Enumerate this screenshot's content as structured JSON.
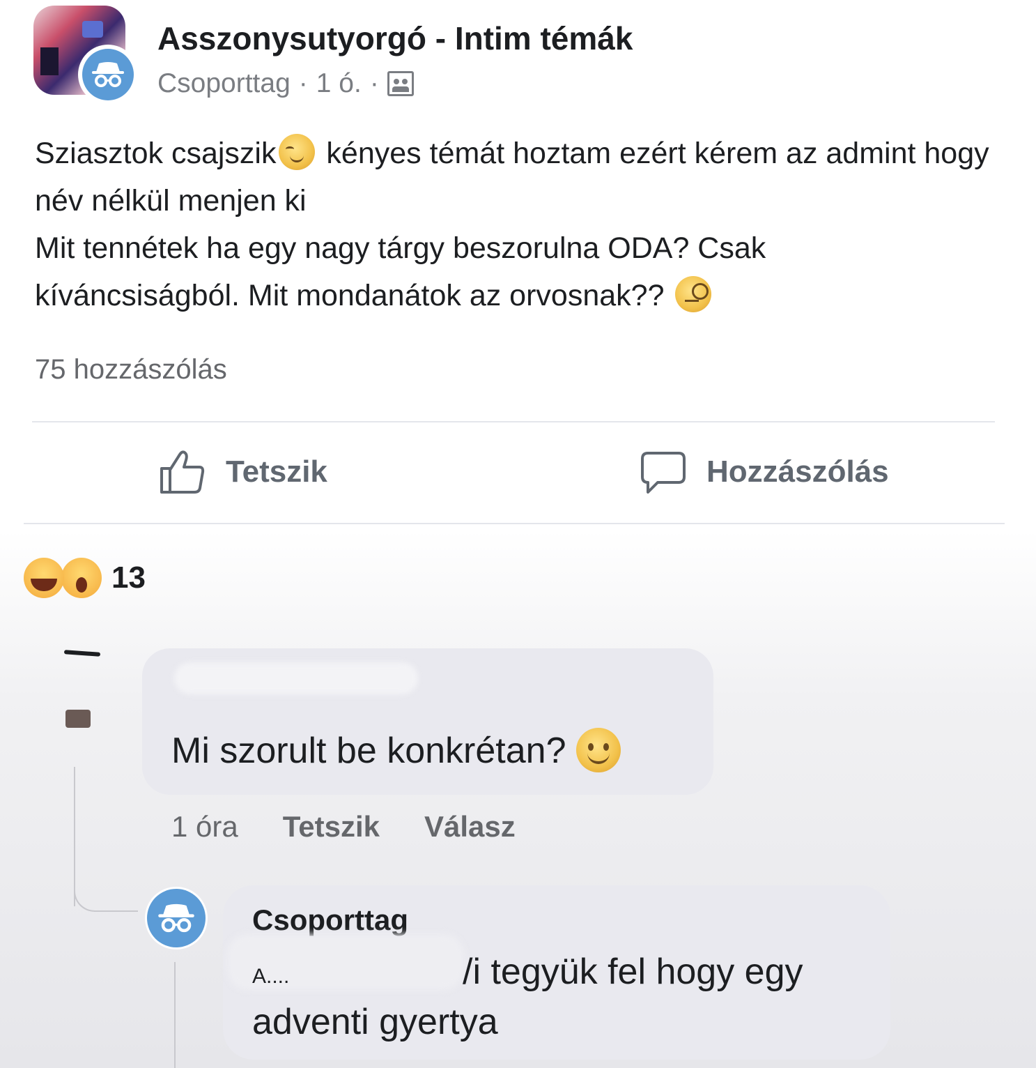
{
  "post": {
    "group_name": "Asszonysutyorgó - Intim témák",
    "author_label": "Csoporttag",
    "separator": "·",
    "time": "1 ó.",
    "text_part1": "Sziasztok csajszik",
    "text_part2": " kényes témát hoztam ezért kérem az admint hogy név nélkül menjen ki",
    "text_line3": "Mit tennétek ha egy nagy tárgy beszorulna ODA? Csak",
    "text_line4": "kíváncsiságból. Mit mondanátok az orvosnak??",
    "comment_count": "75 hozzászólás"
  },
  "actions": {
    "like_label": "Tetszik",
    "comment_label": "Hozzászólás"
  },
  "reactions": {
    "count": "13",
    "types": [
      "haha",
      "wow"
    ]
  },
  "comments": [
    {
      "text": "Mi szorult be konkrétan?",
      "time": "1 óra",
      "like_label": "Tetszik",
      "reply_label": "Válasz"
    }
  ],
  "reply": {
    "author": "Csoporttag",
    "prefix_visible": "A....",
    "line1": "/i tegyük fel hogy egy",
    "line2": "adventi gyertya"
  },
  "colors": {
    "anon_badge": "#5b9bd6",
    "meta_text": "#65676b",
    "bubble": "#e9e9ef"
  },
  "icons": {
    "anonymous": "incognito-icon",
    "privacy": "group-privacy-icon",
    "like": "thumbs-up-icon",
    "comment": "comment-bubble-icon"
  }
}
